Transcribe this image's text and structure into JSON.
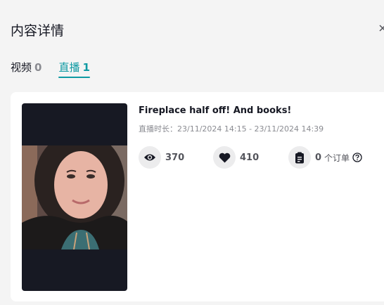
{
  "header": {
    "title": "内容详情"
  },
  "tabs": [
    {
      "label": "视频",
      "count": "0",
      "active": false
    },
    {
      "label": "直播",
      "count": "1",
      "active": true
    }
  ],
  "live": {
    "title": "Fireplace half off! And books!",
    "duration": "直播时长：23/11/2024 14:15 - 23/11/2024 14:39",
    "stats": {
      "views": "370",
      "likes": "410",
      "orders": "0",
      "orders_suffix": "个订单"
    }
  },
  "colors": {
    "accent": "#0f9aa3",
    "page_bg": "#f4f4f4",
    "card_bg": "#ffffff",
    "thumb_bg": "#171923",
    "muted_text": "#8a8b91"
  },
  "icons": {
    "close": "close-icon",
    "views": "eye-icon",
    "likes": "heart-icon",
    "orders": "clipboard-icon",
    "help": "question-circle-icon"
  }
}
